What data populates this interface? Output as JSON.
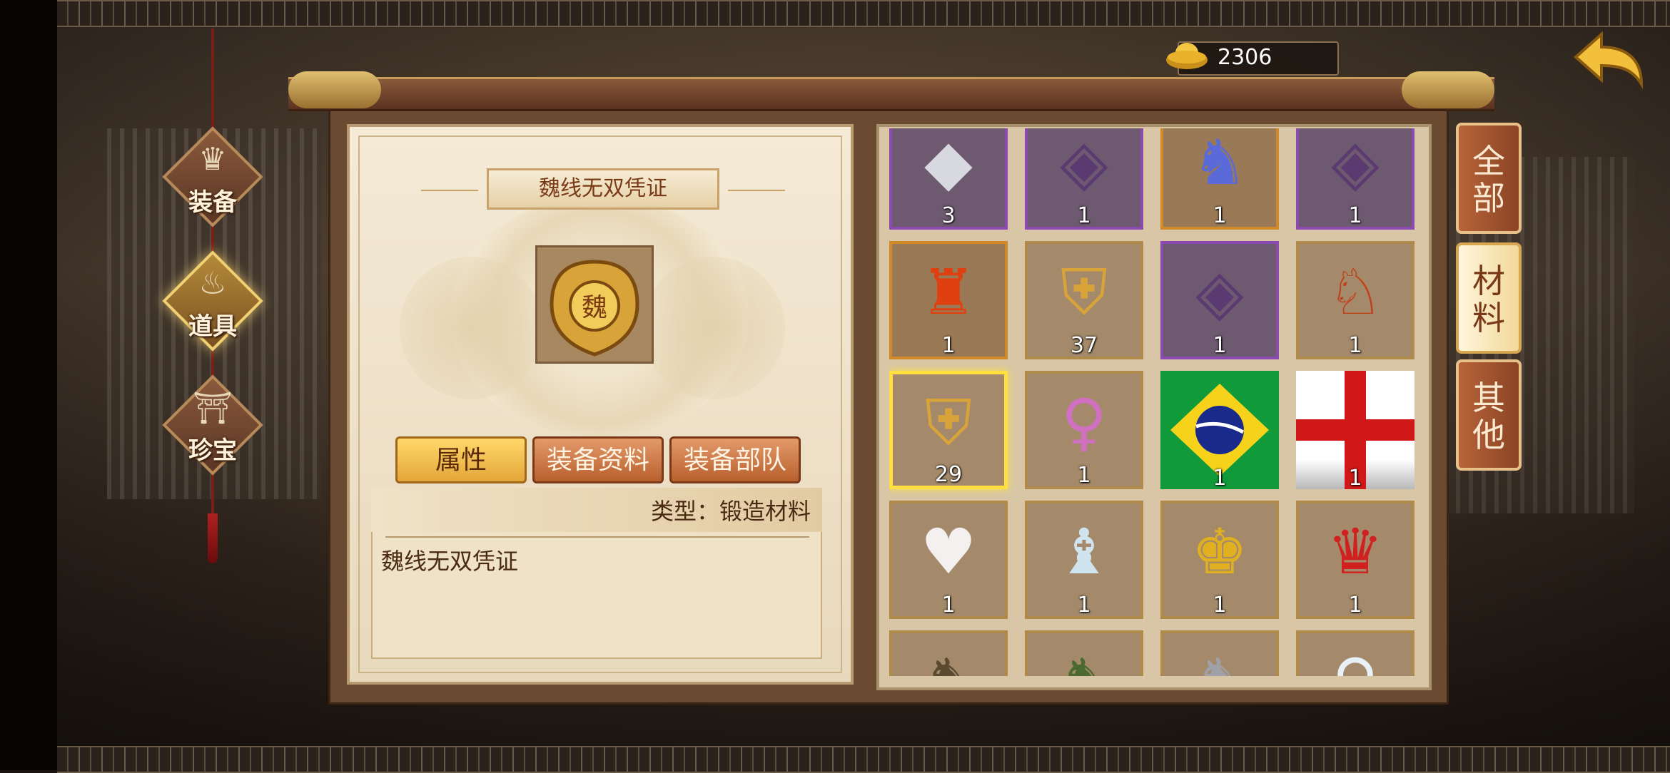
{
  "currency": {
    "icon": "gold-ingot-icon",
    "value": "2306"
  },
  "nav": {
    "items": [
      {
        "label": "装备",
        "icon": "equipment-icon"
      },
      {
        "label": "道具",
        "icon": "item-bag-icon",
        "active": true
      },
      {
        "label": "珍宝",
        "icon": "treasure-chest-icon"
      }
    ]
  },
  "detail": {
    "title": "魏线无双凭证",
    "icon": "wei-token-icon",
    "tabs": [
      "属性",
      "装备资料",
      "装备部队"
    ],
    "type_text": "类型：锻造材料",
    "description": "魏线无双凭证"
  },
  "filter_tabs": [
    {
      "chars": [
        "全",
        "部"
      ]
    },
    {
      "chars": [
        "材",
        "料"
      ],
      "active": true
    },
    {
      "chars": [
        "其",
        "他"
      ]
    }
  ],
  "items": [
    {
      "icon": "silver-ore-icon",
      "count": "3",
      "rarity": "purple"
    },
    {
      "icon": "purple-ore-icon",
      "count": "1",
      "rarity": "purple"
    },
    {
      "icon": "warrior-ice-icon",
      "count": "1",
      "rarity": "orange"
    },
    {
      "icon": "purple-ore-icon",
      "count": "1",
      "rarity": "purple"
    },
    {
      "icon": "fire-warrior-icon",
      "count": "1",
      "rarity": "orange"
    },
    {
      "icon": "shu-token-icon",
      "count": "37",
      "rarity": "gold"
    },
    {
      "icon": "purple-ore-icon",
      "count": "1",
      "rarity": "purple"
    },
    {
      "icon": "flame-chariot-icon",
      "count": "1",
      "rarity": "gold"
    },
    {
      "icon": "wei-token-icon",
      "count": "29",
      "rarity": "gold",
      "selected": true
    },
    {
      "icon": "dancer-icon",
      "count": "1",
      "rarity": "gold"
    },
    {
      "icon": "brazil-flag-icon",
      "count": "1",
      "rarity": "none"
    },
    {
      "icon": "england-flag-icon",
      "count": "1",
      "rarity": "none"
    },
    {
      "icon": "white-rabbit-icon",
      "count": "1",
      "rarity": "gold"
    },
    {
      "icon": "ice-mage-icon",
      "count": "1",
      "rarity": "gold"
    },
    {
      "icon": "golden-general-icon",
      "count": "1",
      "rarity": "gold"
    },
    {
      "icon": "red-demon-icon",
      "count": "1",
      "rarity": "gold"
    },
    {
      "icon": "general-sword-icon",
      "count": "",
      "rarity": "gold"
    },
    {
      "icon": "general-cavalry-icon",
      "count": "",
      "rarity": "gold"
    },
    {
      "icon": "general-silver-icon",
      "count": "",
      "rarity": "gold"
    },
    {
      "icon": "fairy-icon",
      "count": "",
      "rarity": "gold"
    }
  ]
}
